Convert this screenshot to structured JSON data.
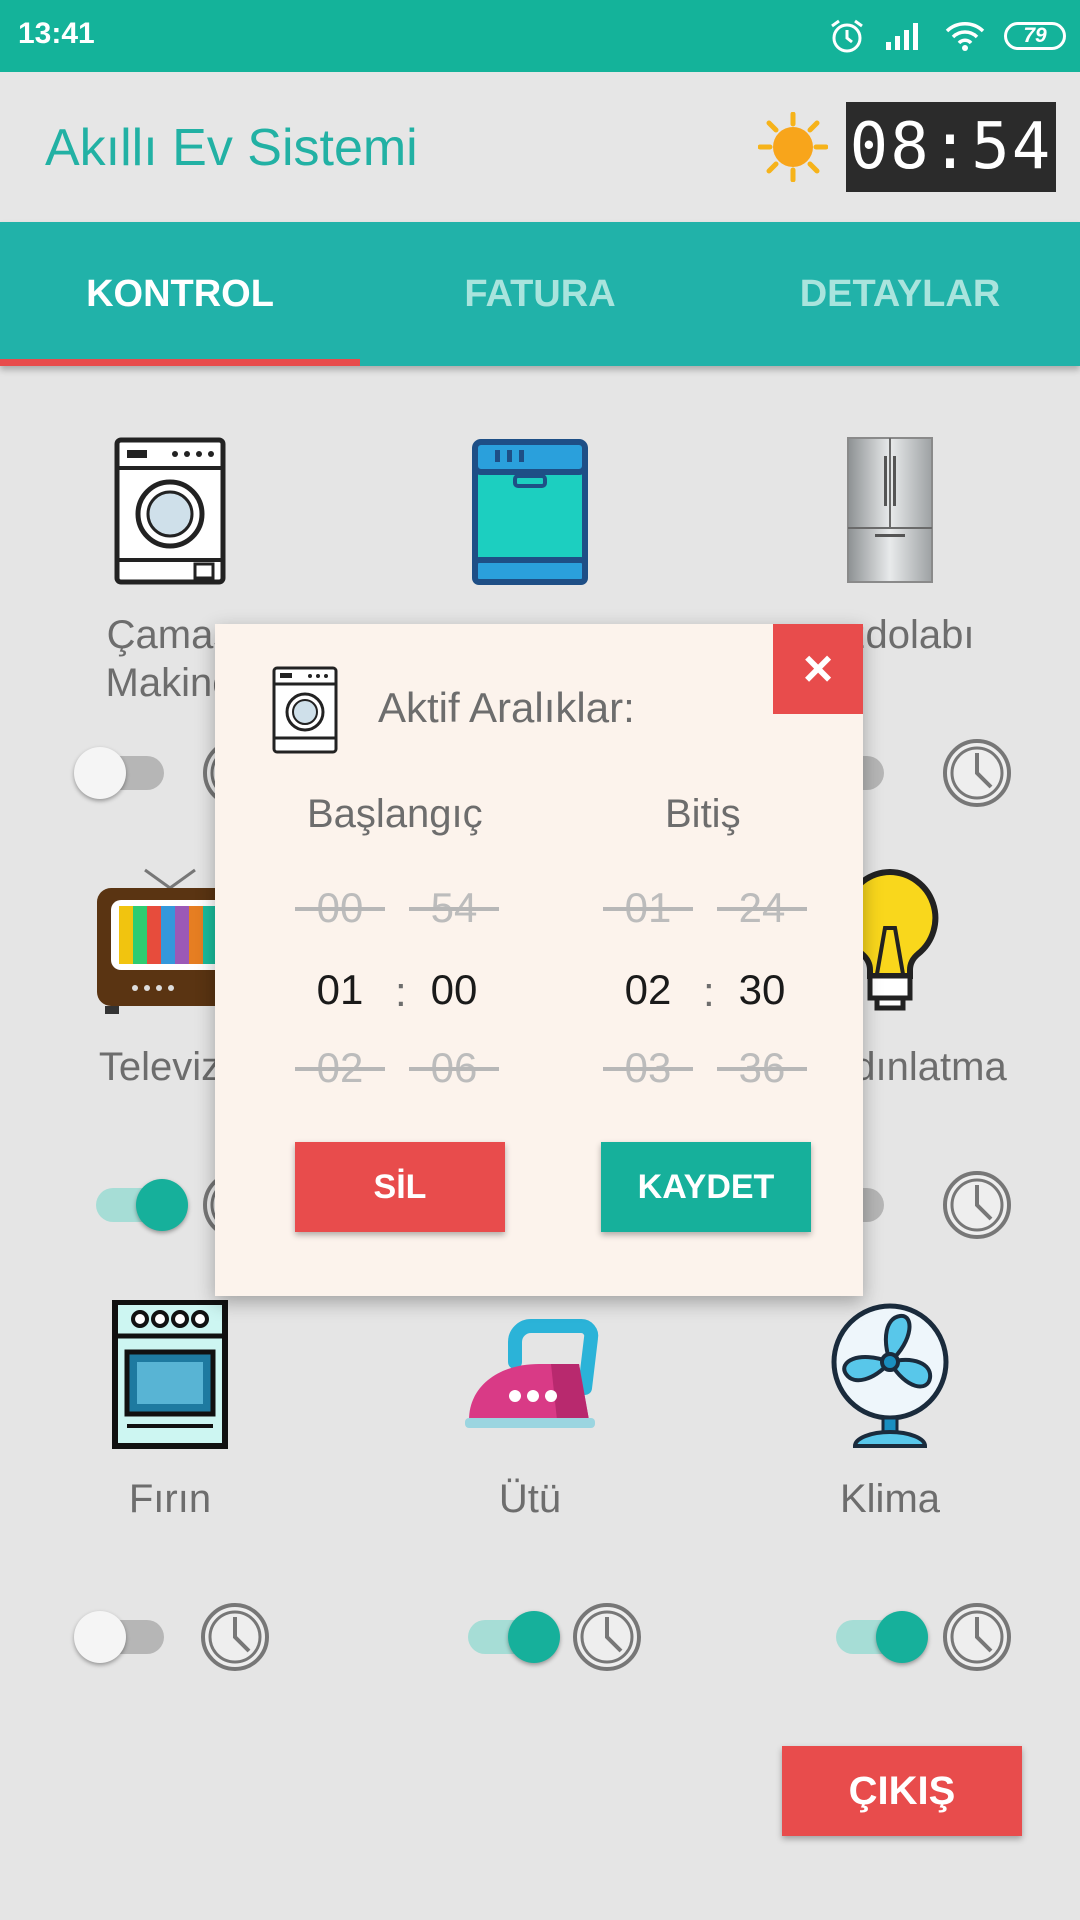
{
  "status_bar": {
    "time": "13:41",
    "battery": "79"
  },
  "header": {
    "title": "Akıllı Ev Sistemi",
    "clock": "08:54"
  },
  "tabs": [
    {
      "label": "KONTROL",
      "active": true
    },
    {
      "label": "FATURA",
      "active": false
    },
    {
      "label": "DETAYLAR",
      "active": false
    }
  ],
  "devices": [
    {
      "label": "Çamaşır Makinesi",
      "visible_label": "Çamaş\nMakine",
      "on": false
    },
    {
      "label": "Bulaşık",
      "visible_label": "",
      "on": false
    },
    {
      "label": "Buzdolabı",
      "visible_label": "zdolabı",
      "on": false
    },
    {
      "label": "Televizyon",
      "visible_label": "Televizy",
      "on": true
    },
    {
      "label": "",
      "visible_label": "",
      "on": false
    },
    {
      "label": "Aydınlatma",
      "visible_label": "dınlatma",
      "on": false
    },
    {
      "label": "Fırın",
      "visible_label": "Fırın",
      "on": false
    },
    {
      "label": "Ütü",
      "visible_label": "Ütü",
      "on": true
    },
    {
      "label": "Klima",
      "visible_label": "Klima",
      "on": true
    }
  ],
  "exit_label": "ÇIKIŞ",
  "dialog": {
    "title": "Aktif Aralıklar:",
    "close_label": "×",
    "start": {
      "heading": "Başlangıç",
      "hours": [
        "00",
        "01",
        "02"
      ],
      "minutes": [
        "54",
        "00",
        "06"
      ]
    },
    "end": {
      "heading": "Bitiş",
      "hours": [
        "01",
        "02",
        "03"
      ],
      "minutes": [
        "24",
        "30",
        "36"
      ]
    },
    "separator": ":",
    "delete_label": "SİL",
    "save_label": "KAYDET"
  },
  "colors": {
    "primary": "#14b39a",
    "accent": "#e84c4c",
    "title": "#22b1a4"
  }
}
